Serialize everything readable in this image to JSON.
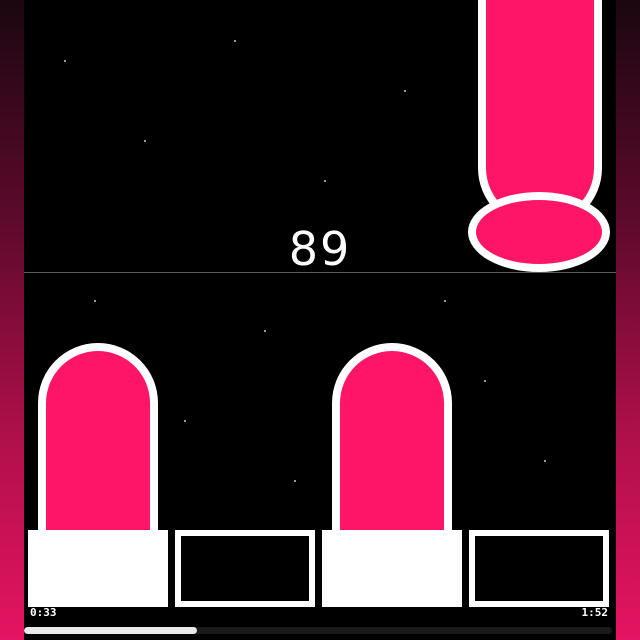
{
  "hud": {
    "score": "89",
    "time_elapsed": "0:33",
    "time_total": "1:52",
    "progress": 0.295
  },
  "colors": {
    "tile": "#ff1567",
    "tile_border": "#ffffff",
    "background": "#000000"
  },
  "lanes": [
    {
      "state": "pressed"
    },
    {
      "state": "idle"
    },
    {
      "state": "pressed"
    },
    {
      "state": "idle"
    }
  ]
}
